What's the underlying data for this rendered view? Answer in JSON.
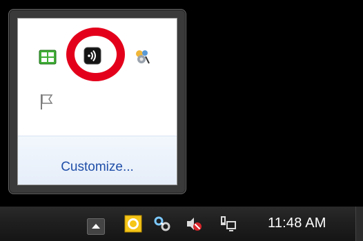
{
  "overflow_popup": {
    "icons": [
      "green-grid-icon",
      "sound-app-icon",
      "network-settings-icon",
      "action-center-flag-icon"
    ],
    "highlighted_icon": "sound-app-icon",
    "customize_label": "Customize..."
  },
  "taskbar": {
    "clock": "11:48 AM",
    "icons": [
      "show-hidden-icons-arrow",
      "outlook-icon",
      "link-icon",
      "volume-muted-icon",
      "network-icon"
    ]
  },
  "colors": {
    "highlight_circle": "#e3001b",
    "link": "#1f4ea8"
  }
}
